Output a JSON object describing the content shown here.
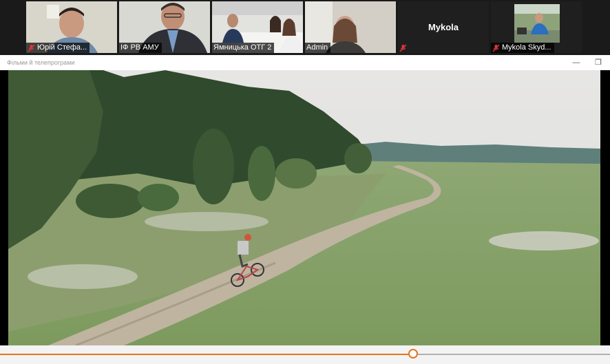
{
  "participants": [
    {
      "name": "Юрій Стефа...",
      "muted": true,
      "active": false
    },
    {
      "name": "ІФ РВ АМУ",
      "muted": false,
      "active": false
    },
    {
      "name": "Ямницька ОТГ 2",
      "muted": false,
      "active": false
    },
    {
      "name": "Admin",
      "muted": false,
      "active": true
    },
    {
      "name": "Mykola",
      "muted": true,
      "active": false,
      "no_video": true
    },
    {
      "name": "Mykola Skyd...",
      "muted": true,
      "active": false
    }
  ],
  "share_window": {
    "title": "Фільми й телепрограми",
    "minimize_icon": "minimize-icon",
    "restore_icon": "restore-icon"
  },
  "player": {
    "progress": 0.677
  },
  "colors": {
    "active_border": "#6bbf2c",
    "progress_accent": "#e3761d",
    "mute_icon": "#e0333a"
  }
}
